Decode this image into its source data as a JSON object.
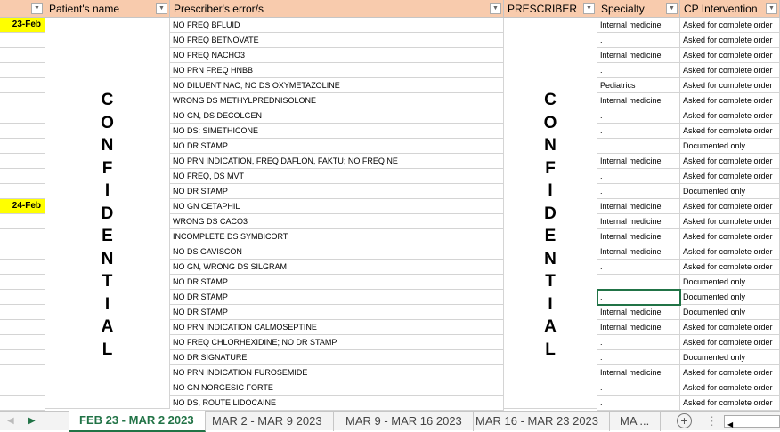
{
  "headers": {
    "a": "",
    "patient": "Patient's name",
    "error": "Prescriber's error/s",
    "prescriber": "PRESCRIBER",
    "specialty": "Specialty",
    "intervention": "CP Intervention"
  },
  "confidential_letters": [
    "C",
    "O",
    "N",
    "F",
    "I",
    "D",
    "E",
    "N",
    "T",
    "I",
    "A",
    "L"
  ],
  "rows": [
    {
      "date": "23-Feb",
      "error": "NO FREQ BFLUID",
      "specialty": "Internal medicine",
      "intervention": "Asked for complete order"
    },
    {
      "date": "",
      "error": "NO FREQ BETNOVATE",
      "specialty": ".",
      "intervention": "Asked for complete order"
    },
    {
      "date": "",
      "error": "NO FREQ NACHO3",
      "specialty": "Internal medicine",
      "intervention": "Asked for complete order"
    },
    {
      "date": "",
      "error": "NO PRN FREQ HNBB",
      "specialty": ".",
      "intervention": "Asked for complete order"
    },
    {
      "date": "",
      "error": "NO DILUENT NAC; NO DS OXYMETAZOLINE",
      "specialty": "Pediatrics",
      "intervention": "Asked for complete order"
    },
    {
      "date": "",
      "error": "WRONG DS METHYLPREDNISOLONE",
      "specialty": "Internal medicine",
      "intervention": "Asked for complete order"
    },
    {
      "date": "",
      "error": "NO GN, DS DECOLGEN",
      "specialty": ".",
      "intervention": "Asked for complete order"
    },
    {
      "date": "",
      "error": "NO DS: SIMETHICONE",
      "specialty": ".",
      "intervention": "Asked for complete order"
    },
    {
      "date": "",
      "error": "NO DR STAMP",
      "specialty": ".",
      "intervention": "Documented only"
    },
    {
      "date": "",
      "error": "NO PRN INDICATION, FREQ DAFLON, FAKTU; NO FREQ NE",
      "specialty": "Internal medicine",
      "intervention": "Asked for complete order"
    },
    {
      "date": "",
      "error": "NO FREQ, DS MVT",
      "specialty": ".",
      "intervention": "Asked for complete order"
    },
    {
      "date": "",
      "error": "NO DR STAMP",
      "specialty": ".",
      "intervention": "Documented only"
    },
    {
      "date": "24-Feb",
      "error": "NO GN CETAPHIL",
      "specialty": "Internal medicine",
      "intervention": "Asked for complete order"
    },
    {
      "date": "",
      "error": "WRONG DS CACO3",
      "specialty": "Internal medicine",
      "intervention": "Asked for complete order"
    },
    {
      "date": "",
      "error": "INCOMPLETE DS SYMBICORT",
      "specialty": "Internal medicine",
      "intervention": "Asked for complete order"
    },
    {
      "date": "",
      "error": "NO DS GAVISCON",
      "specialty": "Internal medicine",
      "intervention": "Asked for complete order"
    },
    {
      "date": "",
      "error": "NO GN, WRONG DS SILGRAM",
      "specialty": ".",
      "intervention": "Asked for complete order"
    },
    {
      "date": "",
      "error": "NO DR STAMP",
      "specialty": ".",
      "intervention": "Documented only"
    },
    {
      "date": "",
      "error": "NO DR STAMP",
      "specialty": ".",
      "intervention": "Documented only"
    },
    {
      "date": "",
      "error": "NO DR STAMP",
      "specialty": "Internal medicine",
      "intervention": "Documented only"
    },
    {
      "date": "",
      "error": "NO PRN INDICATION CALMOSEPTINE",
      "specialty": "Internal medicine",
      "intervention": "Asked for complete order"
    },
    {
      "date": "",
      "error": "NO FREQ CHLORHEXIDINE; NO DR STAMP",
      "specialty": ".",
      "intervention": "Asked for complete order"
    },
    {
      "date": "",
      "error": "NO DR SIGNATURE",
      "specialty": ".",
      "intervention": "Documented only"
    },
    {
      "date": "",
      "error": "NO PRN INDICATION FUROSEMIDE",
      "specialty": "Internal medicine",
      "intervention": "Asked for complete order"
    },
    {
      "date": "",
      "error": "NO GN NORGESIC FORTE",
      "specialty": ".",
      "intervention": "Asked for complete order"
    },
    {
      "date": "",
      "error": "NO DS, ROUTE LIDOCAINE",
      "specialty": ".",
      "intervention": "Asked for complete order"
    }
  ],
  "selected_row": 18,
  "tabs": [
    "FEB 23 - MAR 2 2023",
    "MAR 2 - MAR 9 2023",
    "MAR 9 - MAR 16 2023",
    "MAR 16 - MAR 23 2023",
    "MA ..."
  ],
  "active_tab": 0
}
